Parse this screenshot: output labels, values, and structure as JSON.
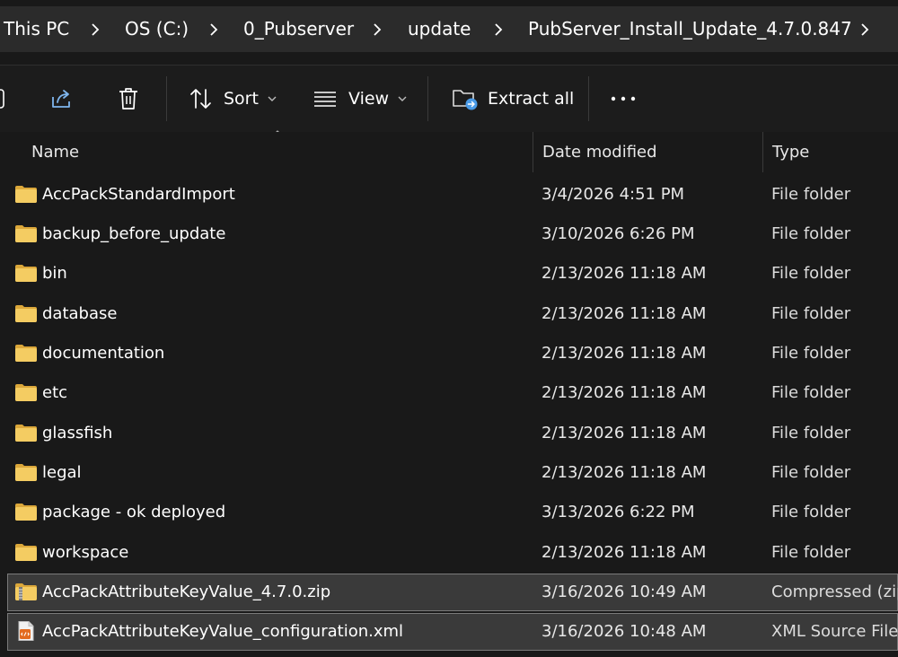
{
  "breadcrumb": {
    "items": [
      "This PC",
      "OS (C:)",
      "0_Pubserver",
      "update",
      "PubServer_Install_Update_4.7.0.847"
    ]
  },
  "toolbar": {
    "sort_label": "Sort",
    "view_label": "View",
    "extract_label": "Extract all",
    "more_label": "•••"
  },
  "columns": {
    "name": "Name",
    "date": "Date modified",
    "type": "Type"
  },
  "colors": {
    "folder": "#f0c75e",
    "selection": "#3a3a3a",
    "accent_icon": "#4a9be8"
  },
  "files": [
    {
      "name": "AccPackStandardImport",
      "date": "3/4/2026 4:51 PM",
      "type": "File folder",
      "icon": "folder-icon"
    },
    {
      "name": "backup_before_update",
      "date": "3/10/2026 6:26 PM",
      "type": "File folder",
      "icon": "folder-icon"
    },
    {
      "name": "bin",
      "date": "2/13/2026 11:18 AM",
      "type": "File folder",
      "icon": "folder-icon"
    },
    {
      "name": "database",
      "date": "2/13/2026 11:18 AM",
      "type": "File folder",
      "icon": "folder-icon"
    },
    {
      "name": "documentation",
      "date": "2/13/2026 11:18 AM",
      "type": "File folder",
      "icon": "folder-icon"
    },
    {
      "name": "etc",
      "date": "2/13/2026 11:18 AM",
      "type": "File folder",
      "icon": "folder-icon"
    },
    {
      "name": "glassfish",
      "date": "2/13/2026 11:18 AM",
      "type": "File folder",
      "icon": "folder-icon"
    },
    {
      "name": "legal",
      "date": "2/13/2026 11:18 AM",
      "type": "File folder",
      "icon": "folder-icon"
    },
    {
      "name": "package - ok deployed",
      "date": "3/13/2026 6:22 PM",
      "type": "File folder",
      "icon": "folder-icon"
    },
    {
      "name": "workspace",
      "date": "2/13/2026 11:18 AM",
      "type": "File folder",
      "icon": "folder-icon"
    },
    {
      "name": "AccPackAttributeKeyValue_4.7.0.zip",
      "date": "3/16/2026 10:49 AM",
      "type": "Compressed (zip",
      "icon": "zip-folder-icon",
      "selected": true
    },
    {
      "name": "AccPackAttributeKeyValue_configuration.xml",
      "date": "3/16/2026 10:48 AM",
      "type": "XML Source File",
      "icon": "xml-file-icon",
      "selected": true
    }
  ]
}
